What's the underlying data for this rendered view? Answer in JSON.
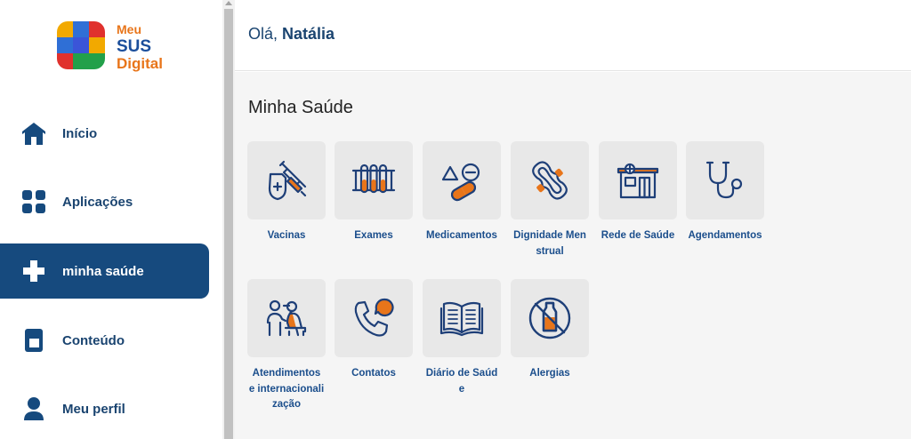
{
  "logo": {
    "line1": "Meu",
    "line2": "SUS",
    "line3": "Digital"
  },
  "header": {
    "greeting_prefix": "Olá,",
    "user_name": "Natália"
  },
  "sidebar": {
    "items": [
      {
        "label": "Início",
        "icon": "home-icon"
      },
      {
        "label": "Aplicações",
        "icon": "apps-grid-icon"
      },
      {
        "label": "minha saúde",
        "icon": "health-cross-icon",
        "active": true
      },
      {
        "label": "Conteúdo",
        "icon": "book-icon"
      },
      {
        "label": "Meu perfil",
        "icon": "user-icon"
      }
    ]
  },
  "main": {
    "section_title": "Minha Saúde",
    "tiles": [
      {
        "label": "Vacinas",
        "icon": "vaccine-icon"
      },
      {
        "label": "Exames",
        "icon": "test-tubes-icon"
      },
      {
        "label": "Medicamentos",
        "icon": "pills-icon"
      },
      {
        "label": "Dignidade Menstrual",
        "icon": "sanitary-pad-icon"
      },
      {
        "label": "Rede de Saúde",
        "icon": "hospital-icon"
      },
      {
        "label": "Agendamentos",
        "icon": "stethoscope-icon"
      },
      {
        "label": "Atendimentos e internacionalização",
        "icon": "doctor-patient-icon"
      },
      {
        "label": "Contatos",
        "icon": "phone-chat-icon"
      },
      {
        "label": "Diário de Saúde",
        "icon": "open-book-icon"
      },
      {
        "label": "Alergias",
        "icon": "allergy-milk-icon"
      }
    ]
  },
  "colors": {
    "primary": "#164a7e",
    "accent": "#e8751a",
    "tile_bg": "#e8e8e8",
    "main_bg": "#f5f5f5"
  }
}
